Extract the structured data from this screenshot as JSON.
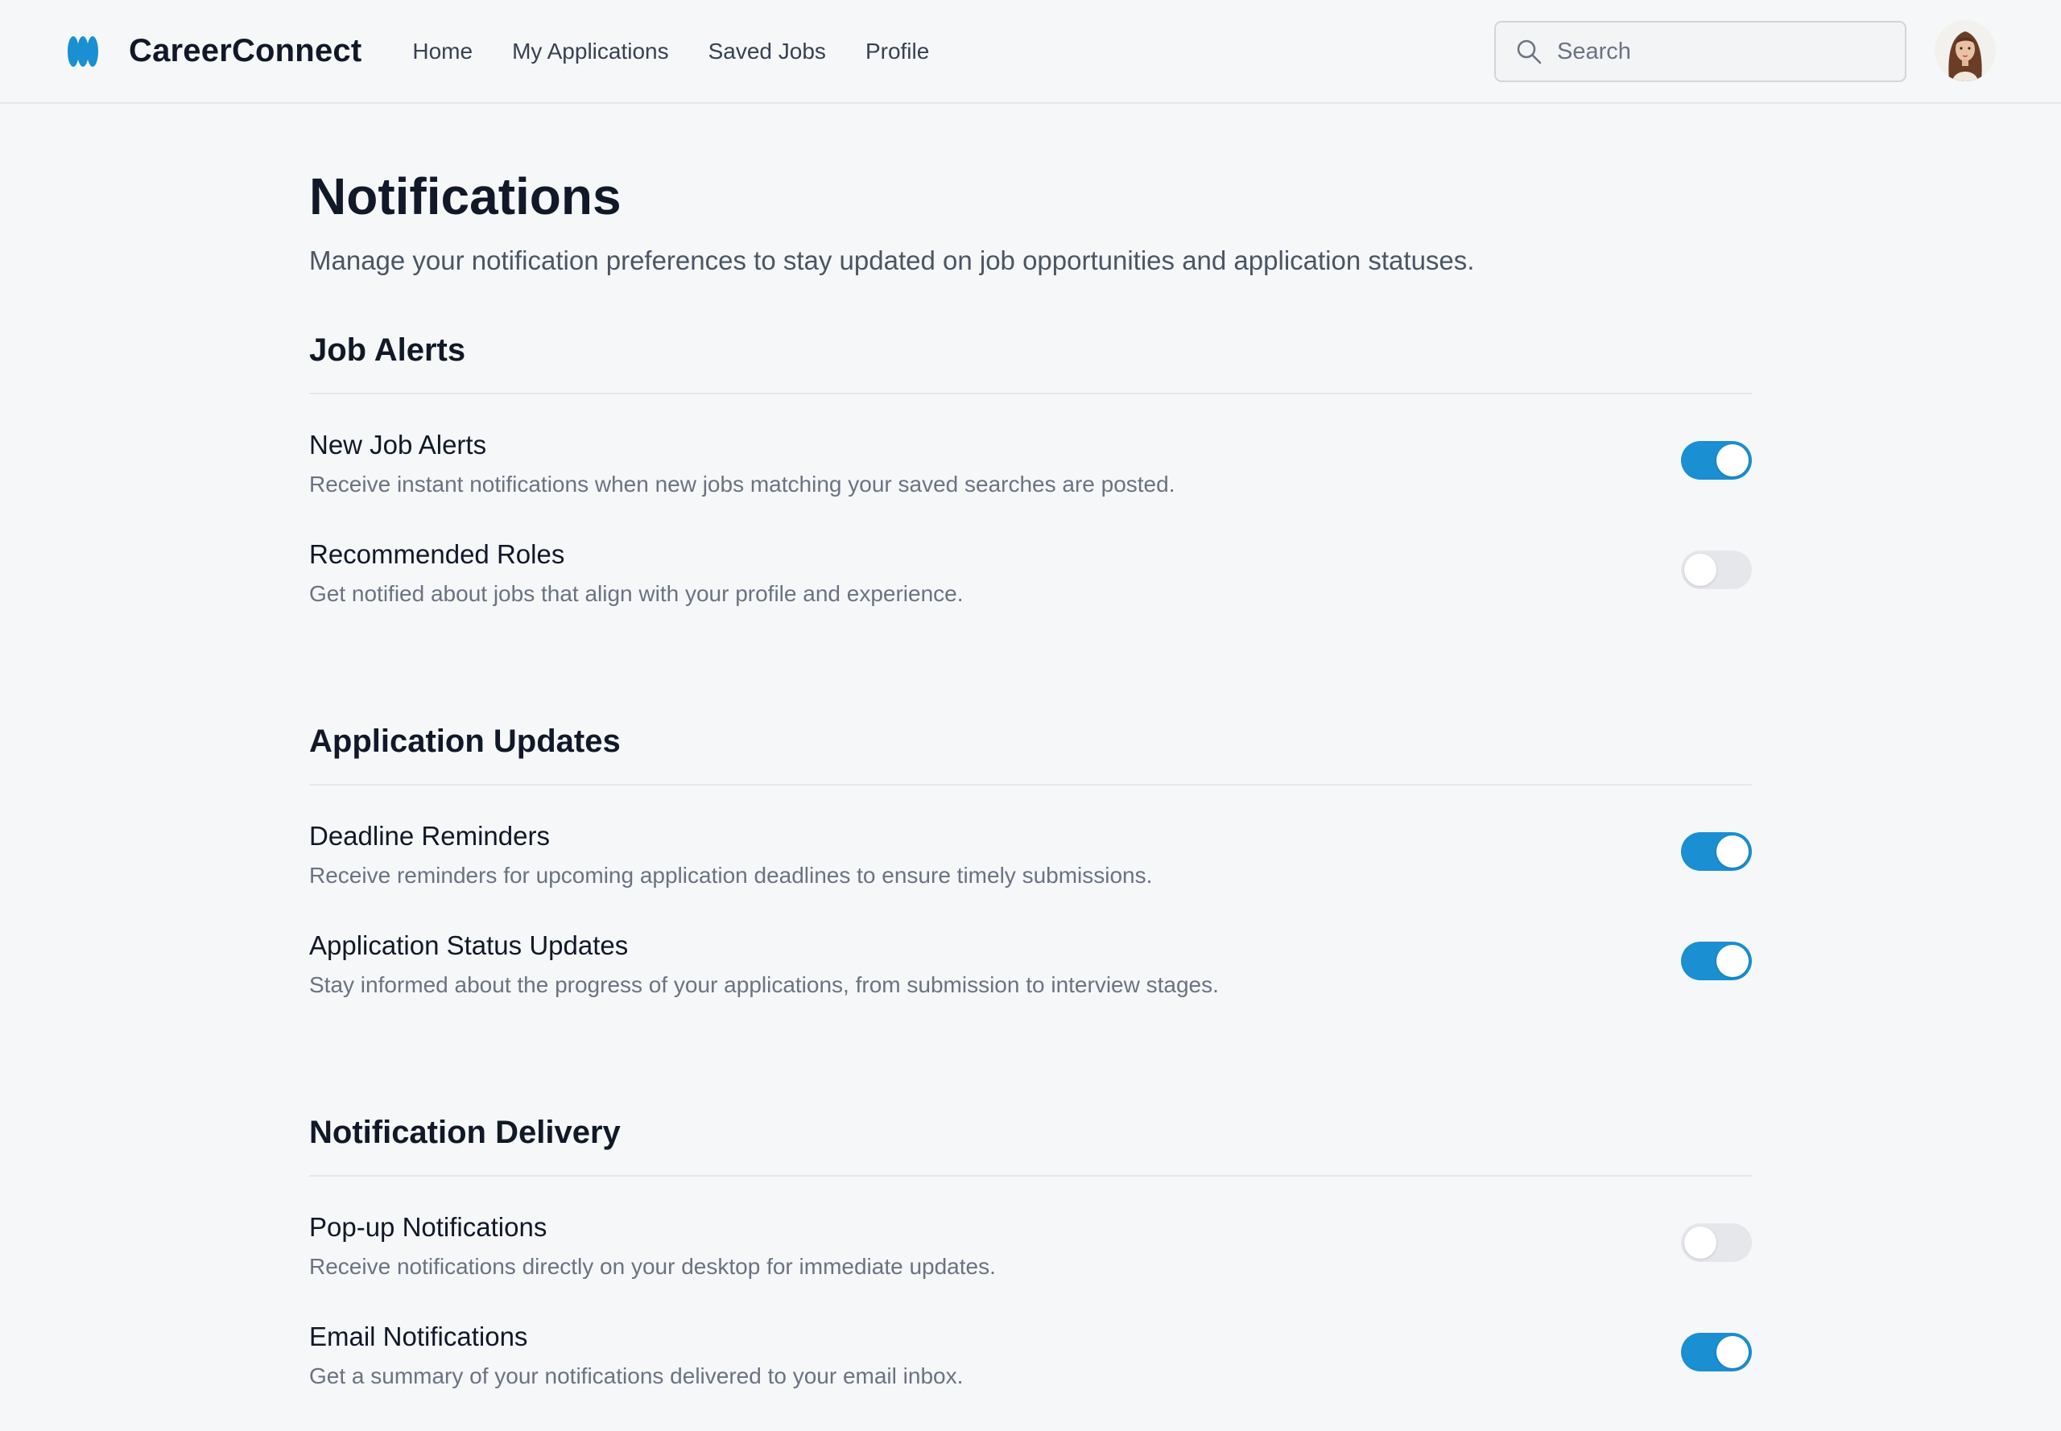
{
  "app": {
    "name": "CareerConnect",
    "accent_color": "#1a8fd1",
    "logo_icon": "brand-logo-icon"
  },
  "nav": {
    "items": [
      {
        "label": "Home"
      },
      {
        "label": "My Applications"
      },
      {
        "label": "Saved Jobs"
      },
      {
        "label": "Profile"
      }
    ]
  },
  "search": {
    "placeholder": "Search",
    "value": "",
    "icon": "search-icon"
  },
  "user": {
    "avatar_icon": "user-avatar"
  },
  "page": {
    "title": "Notifications",
    "subtitle": "Manage your notification preferences to stay updated on job opportunities and application statuses."
  },
  "sections": [
    {
      "title": "Job Alerts",
      "settings": [
        {
          "title": "New Job Alerts",
          "description": "Receive instant notifications when new jobs matching your saved searches are posted.",
          "enabled": true
        },
        {
          "title": "Recommended Roles",
          "description": "Get notified about jobs that align with your profile and experience.",
          "enabled": false
        }
      ]
    },
    {
      "title": "Application Updates",
      "settings": [
        {
          "title": "Deadline Reminders",
          "description": "Receive reminders for upcoming application deadlines to ensure timely submissions.",
          "enabled": true
        },
        {
          "title": "Application Status Updates",
          "description": "Stay informed about the progress of your applications, from submission to interview stages.",
          "enabled": true
        }
      ]
    },
    {
      "title": "Notification Delivery",
      "settings": [
        {
          "title": "Pop-up Notifications",
          "description": "Receive notifications directly on your desktop for immediate updates.",
          "enabled": false
        },
        {
          "title": "Email Notifications",
          "description": "Get a summary of your notifications delivered to your email inbox.",
          "enabled": true
        }
      ]
    }
  ]
}
